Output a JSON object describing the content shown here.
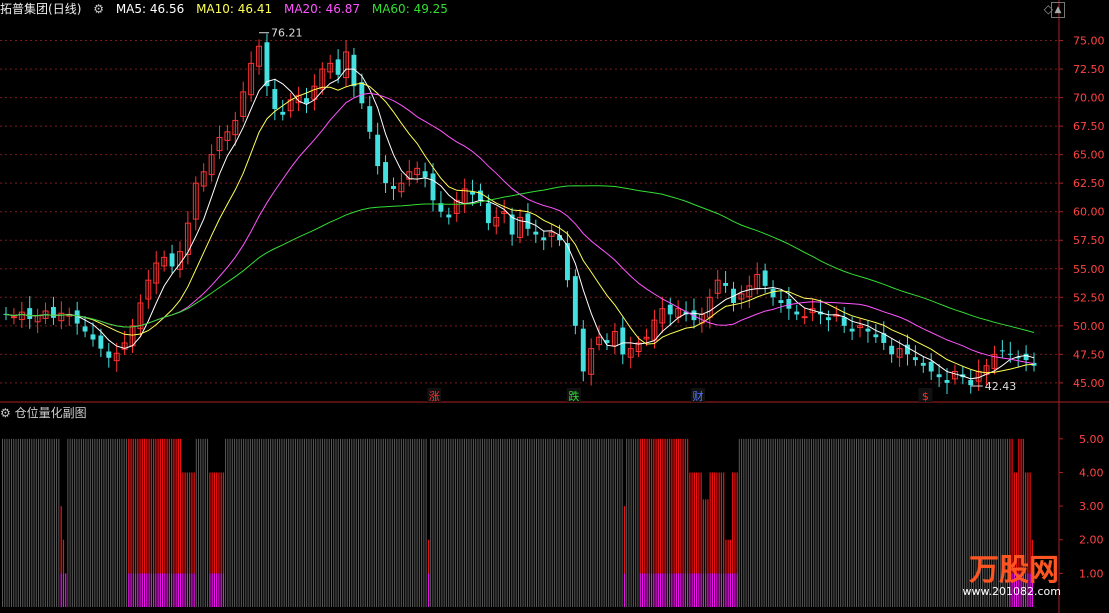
{
  "header": {
    "stock_name": "拓普集团",
    "period": "(日线)",
    "ma": [
      {
        "label": "MA5:",
        "value": "46.56",
        "color": "#ffffff"
      },
      {
        "label": "MA10:",
        "value": "46.41",
        "color": "#ffff55"
      },
      {
        "label": "MA20:",
        "value": "46.87",
        "color": "#ff55ff"
      },
      {
        "label": "MA60:",
        "value": "49.25",
        "color": "#33dd33"
      }
    ]
  },
  "sub_header": {
    "title": "仓位量化副图"
  },
  "watermark": {
    "text": "万股网",
    "url": "www.201082.com"
  },
  "chart_data": [
    {
      "type": "candlestick",
      "ylim": [
        43.5,
        76.8
      ],
      "yticks": [
        "75.00",
        "72.50",
        "70.00",
        "67.50",
        "65.00",
        "62.50",
        "60.00",
        "57.50",
        "55.00",
        "52.50",
        "50.00",
        "47.50",
        "45.00"
      ],
      "grid": true,
      "annotations": [
        {
          "text": "76.21",
          "value": 76.21
        },
        {
          "text": "42.43",
          "value": 42.43
        }
      ],
      "markers": [
        {
          "text": "涨",
          "color": "#ff3333"
        },
        {
          "text": "跌",
          "color": "#33dd33"
        },
        {
          "text": "财",
          "color": "#5577ff"
        },
        {
          "text": "$",
          "color": "#ff3333"
        }
      ],
      "closes": [
        51.0,
        50.8,
        51.2,
        50.6,
        50.9,
        51.3,
        50.7,
        51.1,
        51.0,
        50.2,
        49.5,
        48.8,
        48.0,
        47.2,
        47.6,
        48.5,
        50.0,
        52.0,
        54.0,
        55.5,
        56.0,
        55.2,
        56.5,
        59.0,
        62.5,
        63.5,
        65.0,
        66.5,
        67.0,
        68.0,
        70.5,
        73.0,
        74.5,
        71.0,
        69.0,
        68.5,
        69.8,
        70.2,
        69.5,
        71.0,
        72.5,
        73.0,
        72.0,
        74.0,
        71.0,
        69.5,
        67.0,
        64.0,
        62.5,
        62.0,
        62.5,
        63.5,
        63.8,
        63.0,
        61.0,
        60.0,
        59.5,
        61.0,
        62.0,
        61.5,
        61.0,
        59.0,
        59.5,
        60.0,
        58.0,
        59.5,
        58.5,
        58.0,
        57.5,
        58.2,
        57.5,
        54.0,
        50.0,
        46.0,
        48.0,
        49.0,
        48.5,
        49.5,
        47.5,
        48.0,
        48.5,
        49.0,
        50.5,
        51.5,
        51.0,
        51.5,
        51.0,
        50.5,
        51.0,
        52.5,
        54.0,
        53.5,
        52.0,
        52.8,
        53.5,
        54.5,
        53.5,
        52.5,
        52.0,
        51.5,
        51.0,
        50.8,
        51.5,
        51.0,
        50.5,
        51.0,
        50.0,
        49.5,
        50.0,
        49.5,
        49.0,
        48.5,
        47.5,
        48.0,
        47.5,
        47.0,
        46.5,
        46.0,
        45.5,
        45.0,
        46.0,
        45.5,
        44.8,
        46.0,
        46.5,
        47.5,
        47.8,
        47.5,
        47.2,
        47.0,
        46.5
      ],
      "series": [
        {
          "name": "MA5",
          "color": "#ffffff"
        },
        {
          "name": "MA10",
          "color": "#ffff55"
        },
        {
          "name": "MA20",
          "color": "#ff55ff"
        },
        {
          "name": "MA60",
          "color": "#33dd33"
        }
      ]
    },
    {
      "type": "bar",
      "ylim": [
        0,
        5.5
      ],
      "yticks": [
        "5.00",
        "4.00",
        "3.00",
        "2.00",
        "1.00"
      ],
      "values": [
        0,
        0,
        0,
        0,
        0,
        0,
        0,
        0,
        0,
        0,
        0,
        0,
        0,
        0,
        0,
        0,
        0,
        0,
        0,
        0,
        0,
        0,
        0,
        0,
        0,
        0,
        3,
        2,
        1,
        0,
        0,
        0,
        0,
        0,
        0,
        0,
        0,
        0,
        0,
        0,
        0,
        0,
        0,
        0,
        0,
        0,
        0,
        0,
        0,
        0,
        0,
        0,
        0,
        0,
        0,
        0,
        5,
        5,
        5,
        5,
        5,
        5,
        5,
        5,
        5,
        5,
        5,
        5,
        5,
        5,
        5,
        5,
        5,
        5,
        5,
        5,
        5,
        5,
        5,
        5,
        4,
        4,
        4,
        4,
        4,
        4,
        0,
        0,
        0,
        0,
        0,
        0,
        4,
        4,
        4,
        4,
        4,
        4,
        4,
        0,
        0,
        0,
        0,
        0,
        0,
        0,
        0,
        0,
        0,
        0,
        0,
        0,
        0,
        0,
        0,
        0,
        0,
        0,
        0,
        0,
        0,
        0,
        0,
        0,
        0,
        0,
        0,
        0,
        0,
        0,
        0,
        0,
        0,
        0,
        0,
        0,
        0,
        0,
        0,
        0,
        0,
        0,
        0,
        0,
        0,
        0,
        0,
        0,
        0,
        0,
        0,
        0,
        0,
        0,
        0,
        0,
        0,
        0,
        0,
        0,
        0,
        0,
        0,
        0,
        0,
        0,
        0,
        0,
        0,
        0,
        0,
        0,
        0,
        0,
        0,
        0,
        0,
        0,
        0,
        0,
        0,
        0,
        0,
        0,
        0,
        0,
        0,
        0,
        0,
        2,
        0,
        0,
        0,
        0,
        0,
        0,
        0,
        0,
        0,
        0,
        0,
        0,
        0,
        0,
        0,
        0,
        0,
        0,
        0,
        0,
        0,
        0,
        0,
        0,
        0,
        0,
        0,
        0,
        0,
        0,
        0,
        0,
        0,
        0,
        0,
        0,
        0,
        0,
        0,
        0,
        0,
        0,
        0,
        0,
        0,
        0,
        0,
        0,
        0,
        0,
        0,
        0,
        0,
        0,
        0,
        0,
        0,
        0,
        0,
        0,
        0,
        0,
        0,
        0,
        0,
        0,
        0,
        0,
        0,
        0,
        0,
        0,
        0,
        0,
        0,
        0,
        0,
        0,
        0,
        0,
        0,
        0,
        0,
        0,
        0,
        0,
        3,
        0,
        0,
        0,
        0,
        0,
        0,
        5,
        5,
        5,
        5,
        5,
        5,
        5,
        5,
        5,
        5,
        5,
        5,
        5,
        5,
        5,
        5,
        5,
        5,
        5,
        5,
        5,
        5,
        4,
        4,
        4,
        4,
        4,
        4,
        3.2,
        3.2,
        3.2,
        4,
        4,
        4,
        4,
        4,
        4,
        4,
        2,
        2,
        2,
        4,
        4,
        4,
        0,
        0,
        0,
        0,
        0,
        0,
        0,
        0,
        0,
        0,
        0,
        0,
        0,
        0,
        0,
        0,
        0,
        0,
        0,
        0,
        0,
        0,
        0,
        0,
        0,
        0,
        0,
        0,
        0,
        0,
        0,
        0,
        0,
        0,
        0,
        0,
        0,
        0,
        0,
        0,
        0,
        0,
        0,
        0,
        0,
        0,
        0,
        0,
        0,
        0,
        0,
        0,
        0,
        0,
        0,
        0,
        0,
        0,
        0,
        0,
        0,
        0,
        0,
        0,
        0,
        0,
        0,
        0,
        0,
        0,
        0,
        0,
        0,
        0,
        0,
        0,
        0,
        0,
        0,
        0,
        0,
        0,
        0,
        0,
        0,
        0,
        0,
        0,
        0,
        0,
        0,
        0,
        0,
        0,
        0,
        0,
        0,
        0,
        0,
        0,
        0,
        0,
        0,
        0,
        0,
        0,
        0,
        0,
        0,
        0,
        0,
        0,
        0,
        0,
        0,
        0,
        0,
        0,
        0,
        0,
        5,
        5,
        4,
        4,
        5,
        5,
        5,
        4,
        4,
        4,
        2
      ],
      "base_value": 1,
      "series": [
        {
          "name": "position",
          "color": "#ee1111"
        },
        {
          "name": "base",
          "color": "#ee11ee"
        }
      ]
    }
  ],
  "icons": {
    "diamond": "◇",
    "scroll": "▲"
  }
}
